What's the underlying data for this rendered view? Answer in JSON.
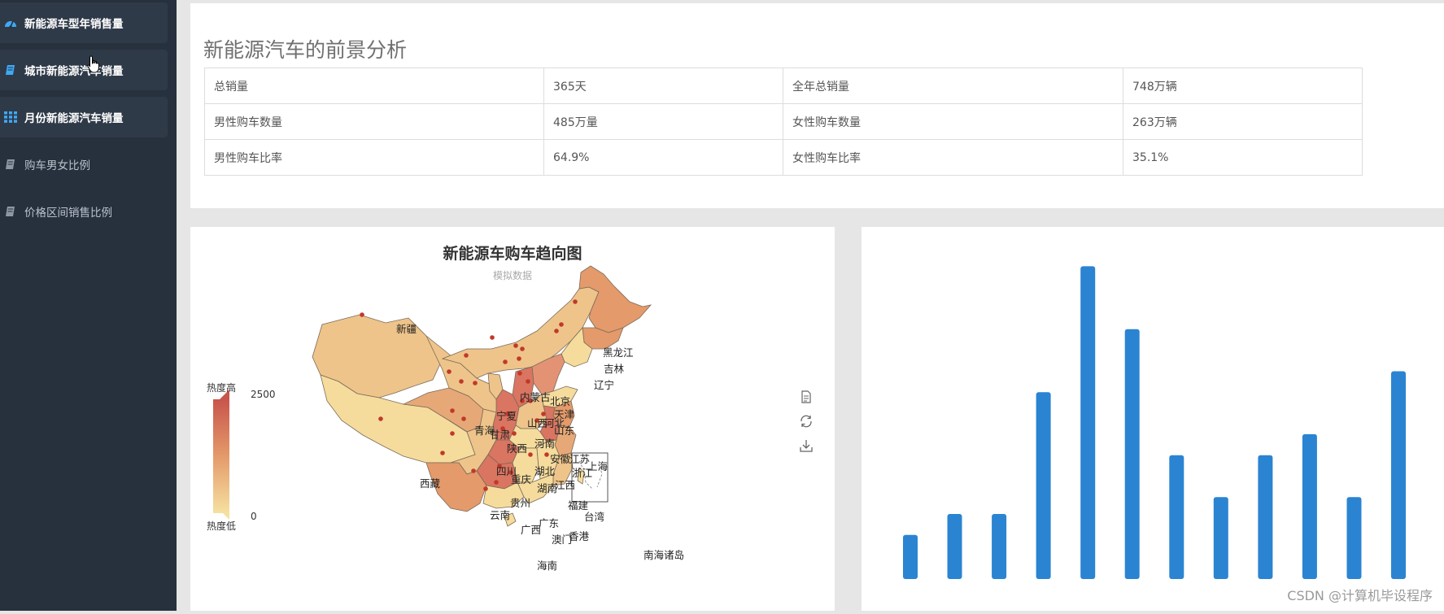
{
  "sidebar": {
    "items": [
      {
        "label": "新能源车型年销售量",
        "icon": "dashboard-icon",
        "active": true
      },
      {
        "label": "城市新能源汽车销量",
        "icon": "book-icon",
        "active": true
      },
      {
        "label": "月份新能源汽车销量",
        "icon": "grid-icon",
        "active": true
      },
      {
        "label": "购车男女比例",
        "icon": "book-icon",
        "active": false
      },
      {
        "label": "价格区间销售比例",
        "icon": "book-icon",
        "active": false
      }
    ]
  },
  "overview": {
    "title": "新能源汽车的前景分析",
    "rows": [
      [
        "总销量",
        "365天",
        "全年总销量",
        "748万辆"
      ],
      [
        "男性购车数量",
        "485万量",
        "女性购车数量",
        "263万辆"
      ],
      [
        "男性购车比率",
        "64.9%",
        "女性购车比率",
        "35.1%"
      ]
    ]
  },
  "map_chart": {
    "title": "新能源车购车趋向图",
    "subtitle": "模拟数据",
    "visual_map": {
      "high_label": "热度高",
      "low_label": "热度低",
      "max": "2500",
      "min": "0"
    },
    "province_labels": [
      "新疆",
      "西藏",
      "黑龙江",
      "吉林",
      "辽宁",
      "内蒙古",
      "北京",
      "天津",
      "河北",
      "山西",
      "宁夏",
      "青海",
      "甘肃",
      "陕西",
      "山东",
      "河南",
      "江苏",
      "安徽",
      "上海",
      "浙江",
      "湖北",
      "四川",
      "重庆",
      "湖南",
      "江西",
      "贵州",
      "福建",
      "台湾",
      "云南",
      "广西",
      "广东",
      "香港",
      "澳门",
      "海南",
      "南海诸岛"
    ],
    "toolbox": [
      "data-view-icon",
      "restore-icon",
      "save-image-icon"
    ],
    "colors": {
      "high": "#c8554c",
      "mid": "#e49a6a",
      "low": "#f6e0a0"
    }
  },
  "chart_data": {
    "type": "bar",
    "values": [
      105,
      155,
      155,
      445,
      745,
      595,
      295,
      195,
      295,
      345,
      195,
      495
    ],
    "ylim": [
      0,
      800
    ],
    "color": "#2a84d2"
  },
  "watermark": "CSDN @计算机毕设程序"
}
